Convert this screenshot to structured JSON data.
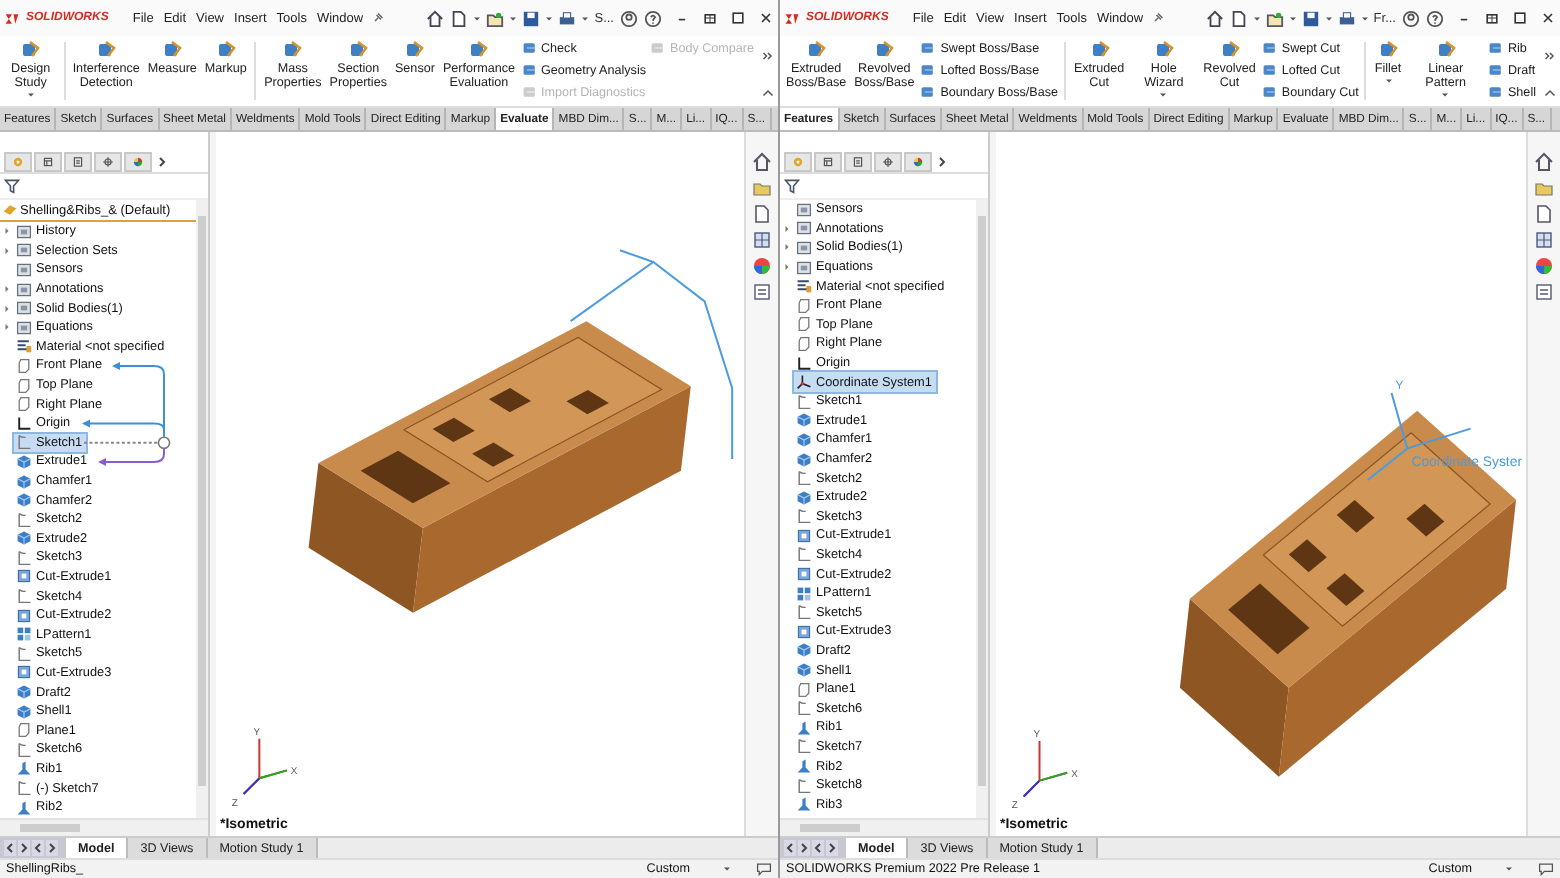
{
  "windows": [
    {
      "kind": "sketch",
      "logo": "SOLIDWORKS",
      "menu": [
        "File",
        "Edit",
        "View",
        "Insert",
        "Tools",
        "Window"
      ],
      "search_text": "S...",
      "ribbon": [
        {
          "kind": "large",
          "label": "Design Study",
          "caret": true
        },
        {
          "kind": "separator"
        },
        {
          "kind": "large",
          "label": "Interference\nDetection",
          "caret": false
        },
        {
          "kind": "large",
          "label": "Measure",
          "caret": false
        },
        {
          "kind": "large",
          "label": "Markup",
          "caret": false
        },
        {
          "kind": "separator"
        },
        {
          "kind": "large",
          "label": "Mass\nProperties",
          "caret": false
        },
        {
          "kind": "large",
          "label": "Section\nProperties",
          "caret": false
        },
        {
          "kind": "large",
          "label": "Sensor",
          "caret": false
        },
        {
          "kind": "large",
          "label": "Performance\nEvaluation",
          "caret": false
        },
        {
          "kind": "stack",
          "items": [
            {
              "label": "Check",
              "disabled": false
            },
            {
              "label": "Geometry Analysis",
              "disabled": false
            },
            {
              "label": "Import Diagnostics",
              "disabled": true
            }
          ]
        },
        {
          "kind": "stack",
          "items": [
            {
              "label": "Body Compare",
              "disabled": true
            }
          ]
        }
      ],
      "tabs": [
        {
          "label": "Features",
          "selected": false
        },
        {
          "label": "Sketch",
          "selected": false
        },
        {
          "label": "Surfaces",
          "selected": false
        },
        {
          "label": "Sheet Metal",
          "selected": false
        },
        {
          "label": "Weldments",
          "selected": false
        },
        {
          "label": "Mold Tools",
          "selected": false
        },
        {
          "label": "Direct Editing",
          "selected": false
        },
        {
          "label": "Markup",
          "selected": false
        },
        {
          "label": "Evaluate",
          "selected": true
        },
        {
          "label": "MBD Dim...",
          "selected": false
        },
        {
          "label": "S...",
          "selected": false
        },
        {
          "label": "M...",
          "selected": false
        },
        {
          "label": "Li...",
          "selected": false
        },
        {
          "label": "IQ...",
          "selected": false
        },
        {
          "label": "S...",
          "selected": false
        }
      ],
      "tree": {
        "root": "Shelling&Ribs_& (Default)",
        "arrows": true,
        "items": [
          {
            "label": "History",
            "kind": "folder",
            "expandable": true,
            "selected": false
          },
          {
            "label": "Selection Sets",
            "kind": "folder",
            "expandable": true,
            "selected": false
          },
          {
            "label": "Sensors",
            "kind": "folder",
            "expandable": false,
            "selected": false
          },
          {
            "label": "Annotations",
            "kind": "folder",
            "expandable": true,
            "selected": false
          },
          {
            "label": "Solid Bodies(1)",
            "kind": "folder",
            "expandable": true,
            "selected": false
          },
          {
            "label": "Equations",
            "kind": "folder",
            "expandable": true,
            "selected": false
          },
          {
            "label": "Material <not specified",
            "kind": "material",
            "expandable": false,
            "selected": false
          },
          {
            "label": "Front Plane",
            "kind": "plane",
            "expandable": false,
            "selected": false
          },
          {
            "label": "Top Plane",
            "kind": "plane",
            "expandable": false,
            "selected": false
          },
          {
            "label": "Right Plane",
            "kind": "plane",
            "expandable": false,
            "selected": false
          },
          {
            "label": "Origin",
            "kind": "origin",
            "expandable": false,
            "selected": false
          },
          {
            "label": "Sketch1",
            "kind": "sketch",
            "expandable": false,
            "selected": true
          },
          {
            "label": "Extrude1",
            "kind": "feature",
            "expandable": false,
            "selected": false
          },
          {
            "label": "Chamfer1",
            "kind": "feature",
            "expandable": false,
            "selected": false
          },
          {
            "label": "Chamfer2",
            "kind": "feature",
            "expandable": false,
            "selected": false
          },
          {
            "label": "Sketch2",
            "kind": "sketch",
            "expandable": false,
            "selected": false
          },
          {
            "label": "Extrude2",
            "kind": "feature",
            "expandable": false,
            "selected": false
          },
          {
            "label": "Sketch3",
            "kind": "sketch",
            "expandable": false,
            "selected": false
          },
          {
            "label": "Cut-Extrude1",
            "kind": "cut",
            "expandable": false,
            "selected": false
          },
          {
            "label": "Sketch4",
            "kind": "sketch",
            "expandable": false,
            "selected": false
          },
          {
            "label": "Cut-Extrude2",
            "kind": "cut",
            "expandable": false,
            "selected": false
          },
          {
            "label": "LPattern1",
            "kind": "pattern",
            "expandable": false,
            "selected": false
          },
          {
            "label": "Sketch5",
            "kind": "sketch",
            "expandable": false,
            "selected": false
          },
          {
            "label": "Cut-Extrude3",
            "kind": "cut",
            "expandable": false,
            "selected": false
          },
          {
            "label": "Draft2",
            "kind": "feature",
            "expandable": false,
            "selected": false
          },
          {
            "label": "Shell1",
            "kind": "feature",
            "expandable": false,
            "selected": false
          },
          {
            "label": "Plane1",
            "kind": "plane",
            "expandable": false,
            "selected": false
          },
          {
            "label": "Sketch6",
            "kind": "sketch",
            "expandable": false,
            "selected": false
          },
          {
            "label": "Rib1",
            "kind": "rib",
            "expandable": false,
            "selected": false
          },
          {
            "label": "(-) Sketch7",
            "kind": "sketch",
            "expandable": false,
            "selected": false
          },
          {
            "label": "Rib2",
            "kind": "rib",
            "expandable": false,
            "selected": false
          }
        ]
      },
      "view": {
        "label": "*Isometric",
        "triad": [
          "Y",
          "X",
          "Z"
        ]
      },
      "bottom_tabs": [
        {
          "label": "Model",
          "selected": true
        },
        {
          "label": "3D Views",
          "selected": false
        },
        {
          "label": "Motion Study 1",
          "selected": false
        }
      ],
      "status": {
        "text": "ShellingRibs_",
        "units": "Custom"
      }
    },
    {
      "kind": "coordinate_system",
      "logo": "SOLIDWORKS",
      "menu": [
        "File",
        "Edit",
        "View",
        "Insert",
        "Tools",
        "Window"
      ],
      "search_text": "Fr...",
      "ribbon": [
        {
          "kind": "large",
          "label": "Extruded\nBoss/Base",
          "caret": false
        },
        {
          "kind": "large",
          "label": "Revolved\nBoss/Base",
          "caret": false
        },
        {
          "kind": "stack",
          "items": [
            {
              "label": "Swept Boss/Base",
              "disabled": false
            },
            {
              "label": "Lofted Boss/Base",
              "disabled": false
            },
            {
              "label": "Boundary Boss/Base",
              "disabled": false
            }
          ]
        },
        {
          "kind": "separator"
        },
        {
          "kind": "large",
          "label": "Extruded\nCut",
          "caret": false
        },
        {
          "kind": "large",
          "label": "Hole Wizard",
          "caret": true
        },
        {
          "kind": "large",
          "label": "Revolved\nCut",
          "caret": false
        },
        {
          "kind": "stack",
          "items": [
            {
              "label": "Swept Cut",
              "disabled": false
            },
            {
              "label": "Lofted Cut",
              "disabled": false
            },
            {
              "label": "Boundary Cut",
              "disabled": false
            }
          ]
        },
        {
          "kind": "separator"
        },
        {
          "kind": "large",
          "label": "Fillet",
          "caret": true
        },
        {
          "kind": "large",
          "label": "Linear Pattern",
          "caret": true
        },
        {
          "kind": "stack",
          "items": [
            {
              "label": "Rib",
              "disabled": false
            },
            {
              "label": "Draft",
              "disabled": false
            },
            {
              "label": "Shell",
              "disabled": false
            }
          ]
        }
      ],
      "tabs": [
        {
          "label": "Features",
          "selected": true
        },
        {
          "label": "Sketch",
          "selected": false
        },
        {
          "label": "Surfaces",
          "selected": false
        },
        {
          "label": "Sheet Metal",
          "selected": false
        },
        {
          "label": "Weldments",
          "selected": false
        },
        {
          "label": "Mold Tools",
          "selected": false
        },
        {
          "label": "Direct Editing",
          "selected": false
        },
        {
          "label": "Markup",
          "selected": false
        },
        {
          "label": "Evaluate",
          "selected": false
        },
        {
          "label": "MBD Dim...",
          "selected": false
        },
        {
          "label": "S...",
          "selected": false
        },
        {
          "label": "M...",
          "selected": false
        },
        {
          "label": "Li...",
          "selected": false
        },
        {
          "label": "IQ...",
          "selected": false
        },
        {
          "label": "S...",
          "selected": false
        }
      ],
      "tree": {
        "items": [
          {
            "label": "Sensors",
            "kind": "folder",
            "expandable": false,
            "selected": false
          },
          {
            "label": "Annotations",
            "kind": "folder",
            "expandable": true,
            "selected": false
          },
          {
            "label": "Solid Bodies(1)",
            "kind": "folder",
            "expandable": true,
            "selected": false
          },
          {
            "label": "Equations",
            "kind": "folder",
            "expandable": true,
            "selected": false
          },
          {
            "label": "Material <not specified",
            "kind": "material",
            "expandable": false,
            "selected": false
          },
          {
            "label": "Front Plane",
            "kind": "plane",
            "expandable": false,
            "selected": false
          },
          {
            "label": "Top Plane",
            "kind": "plane",
            "expandable": false,
            "selected": false
          },
          {
            "label": "Right Plane",
            "kind": "plane",
            "expandable": false,
            "selected": false
          },
          {
            "label": "Origin",
            "kind": "origin",
            "expandable": false,
            "selected": false
          },
          {
            "label": "Coordinate System1",
            "kind": "coord",
            "expandable": false,
            "selected": true
          },
          {
            "label": "Sketch1",
            "kind": "sketch",
            "expandable": false,
            "selected": false
          },
          {
            "label": "Extrude1",
            "kind": "feature",
            "expandable": false,
            "selected": false
          },
          {
            "label": "Chamfer1",
            "kind": "feature",
            "expandable": false,
            "selected": false
          },
          {
            "label": "Chamfer2",
            "kind": "feature",
            "expandable": false,
            "selected": false
          },
          {
            "label": "Sketch2",
            "kind": "sketch",
            "expandable": false,
            "selected": false
          },
          {
            "label": "Extrude2",
            "kind": "feature",
            "expandable": false,
            "selected": false
          },
          {
            "label": "Sketch3",
            "kind": "sketch",
            "expandable": false,
            "selected": false
          },
          {
            "label": "Cut-Extrude1",
            "kind": "cut",
            "expandable": false,
            "selected": false
          },
          {
            "label": "Sketch4",
            "kind": "sketch",
            "expandable": false,
            "selected": false
          },
          {
            "label": "Cut-Extrude2",
            "kind": "cut",
            "expandable": false,
            "selected": false
          },
          {
            "label": "LPattern1",
            "kind": "pattern",
            "expandable": false,
            "selected": false
          },
          {
            "label": "Sketch5",
            "kind": "sketch",
            "expandable": false,
            "selected": false
          },
          {
            "label": "Cut-Extrude3",
            "kind": "cut",
            "expandable": false,
            "selected": false
          },
          {
            "label": "Draft2",
            "kind": "feature",
            "expandable": false,
            "selected": false
          },
          {
            "label": "Shell1",
            "kind": "feature",
            "expandable": false,
            "selected": false
          },
          {
            "label": "Plane1",
            "kind": "plane",
            "expandable": false,
            "selected": false
          },
          {
            "label": "Sketch6",
            "kind": "sketch",
            "expandable": false,
            "selected": false
          },
          {
            "label": "Rib1",
            "kind": "rib",
            "expandable": false,
            "selected": false
          },
          {
            "label": "Sketch7",
            "kind": "sketch",
            "expandable": false,
            "selected": false
          },
          {
            "label": "Rib2",
            "kind": "rib",
            "expandable": false,
            "selected": false
          },
          {
            "label": "Sketch8",
            "kind": "sketch",
            "expandable": false,
            "selected": false
          },
          {
            "label": "Rib3",
            "kind": "rib",
            "expandable": false,
            "selected": false
          }
        ]
      },
      "view": {
        "label": "*Isometric",
        "triad": [
          "Y",
          "X",
          "Z"
        ],
        "annotation": "Coordinate Syster",
        "axis_label": "Y"
      },
      "bottom_tabs": [
        {
          "label": "Model",
          "selected": true
        },
        {
          "label": "3D Views",
          "selected": false
        },
        {
          "label": "Motion Study 1",
          "selected": false
        }
      ],
      "status": {
        "text": "SOLIDWORKS Premium 2022 Pre Release 1",
        "units": "Custom"
      }
    }
  ]
}
